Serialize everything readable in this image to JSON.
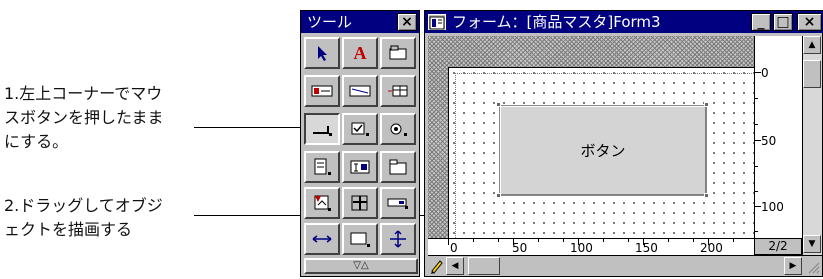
{
  "annotations": {
    "step1": "1.左上コーナーでマウ\nスボタンを押したまま\nにする。",
    "step2": "2.ドラッグしてオブジ\nェクトを描画する"
  },
  "palette": {
    "title": "ツール",
    "close_glyph": "×",
    "footer": "▽△",
    "tools": [
      {
        "name": "pointer-tool-icon"
      },
      {
        "name": "text-tool-icon",
        "glyph": "A"
      },
      {
        "name": "field-tool-icon"
      },
      {
        "name": "label-tool-icon"
      },
      {
        "name": "line-tool-icon"
      },
      {
        "name": "table-tool-icon"
      },
      {
        "name": "button-tool-icon"
      },
      {
        "name": "checkbox-tool-icon"
      },
      {
        "name": "radio-tool-icon"
      },
      {
        "name": "list-tool-icon"
      },
      {
        "name": "combo-tool-icon"
      },
      {
        "name": "tab-tool-icon"
      },
      {
        "name": "image-tool-icon"
      },
      {
        "name": "grid-tool-icon"
      },
      {
        "name": "scrollbar-tool-icon"
      },
      {
        "name": "resize-tool-icon"
      },
      {
        "name": "rectangle-tool-icon"
      },
      {
        "name": "move-tool-icon"
      }
    ]
  },
  "form_window": {
    "title": "フォーム：[商品マスタ]Form3",
    "minimize": "_",
    "maximize": "□",
    "close": "×",
    "button_label": "ボタン",
    "vruler_labels": [
      "0",
      "50",
      "100"
    ],
    "hruler_labels": [
      "0",
      "50",
      "100",
      "150",
      "200"
    ],
    "page_indicator": "2/2"
  }
}
